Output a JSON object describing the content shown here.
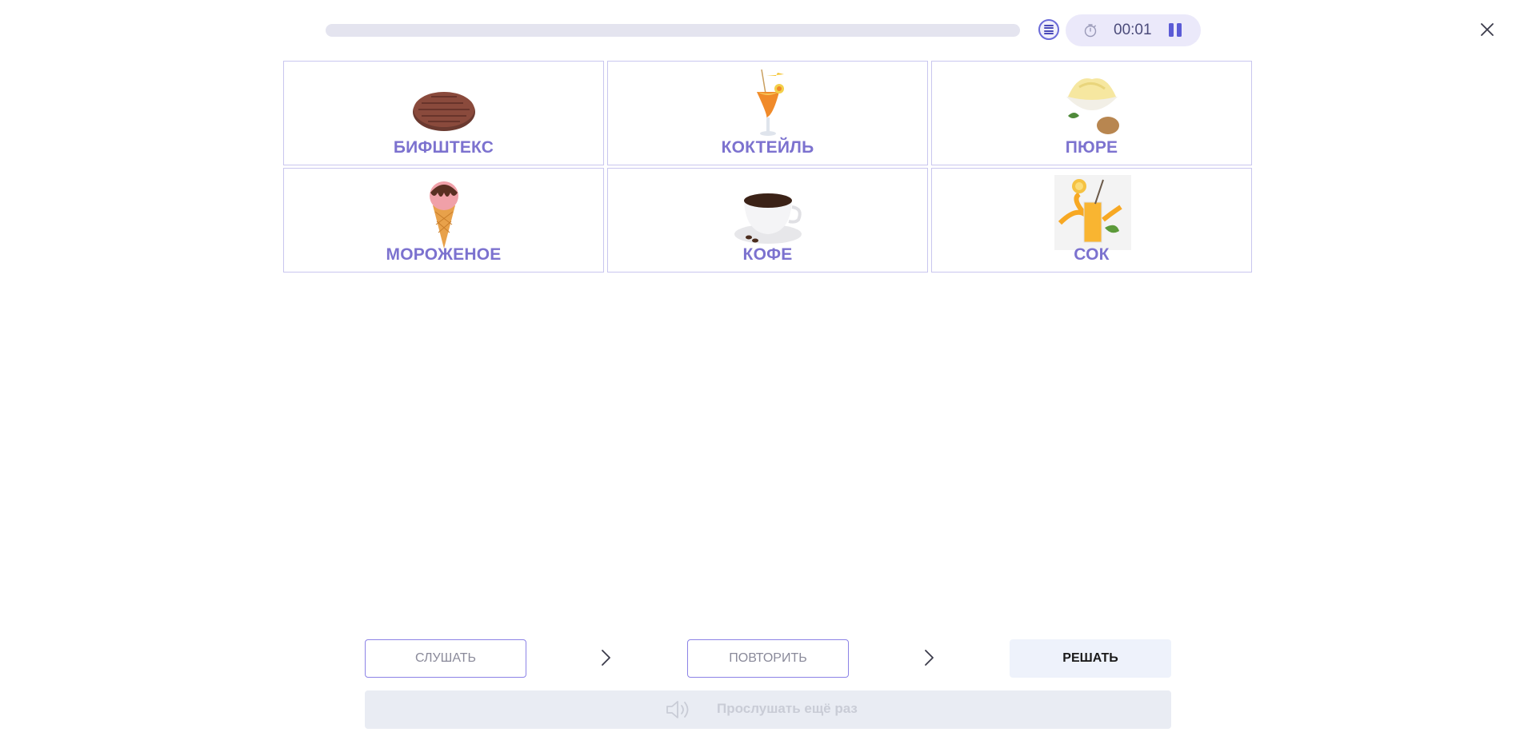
{
  "progress": {
    "fraction": 0.0
  },
  "timer": {
    "time": "00:01"
  },
  "cards": [
    {
      "label": "БИФШТЕКС",
      "icon": "beefsteak-image"
    },
    {
      "label": "КОКТЕЙЛЬ",
      "icon": "cocktail-image"
    },
    {
      "label": "ПЮРЕ",
      "icon": "mashed-potatoes-image"
    },
    {
      "label": "МОРОЖЕНОЕ",
      "icon": "ice-cream-image"
    },
    {
      "label": "КОФЕ",
      "icon": "coffee-image"
    },
    {
      "label": "СОК",
      "icon": "juice-image"
    }
  ],
  "steps": {
    "listen_label": "СЛУШАТЬ",
    "repeat_label": "ПОВТОРИТЬ",
    "solve_label": "РЕШАТЬ"
  },
  "listen_again": {
    "label": "Прослушать ещё раз"
  },
  "colors": {
    "accent": "#7c72cf",
    "card_border": "#c9c6ef",
    "timer_bg": "#ebe9fa",
    "solve_bg": "#eef2fb"
  }
}
